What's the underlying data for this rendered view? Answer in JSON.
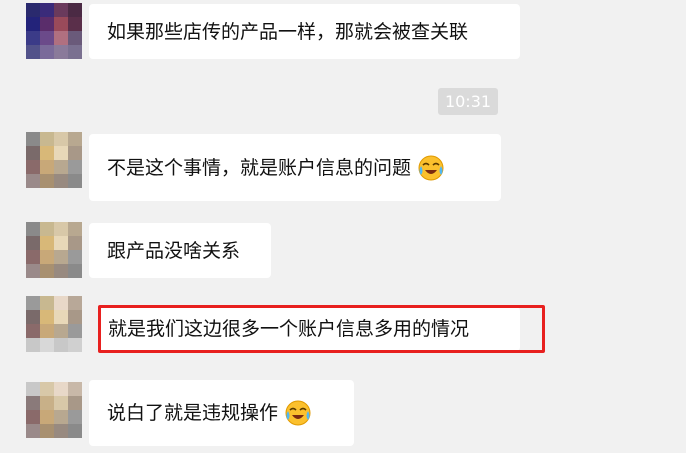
{
  "chat": {
    "timestamp": "10:31",
    "messages": [
      {
        "text": "如果那些店传的产品一样，那就会被查关联",
        "emoji": ""
      },
      {
        "text": "不是这个事情，就是账户信息的问题",
        "emoji": "laughing-crying-emoji"
      },
      {
        "text": "跟产品没啥关系",
        "emoji": ""
      },
      {
        "text": "就是我们这边很多一个账户信息多用的情况",
        "emoji": ""
      },
      {
        "text": "说白了就是违规操作",
        "emoji": "laughing-crying-emoji"
      }
    ]
  },
  "colors": {
    "background": "#f1f1f1",
    "bubble": "#ffffff",
    "highlight": "#e8201f",
    "timestamp_badge": "#dadada"
  }
}
